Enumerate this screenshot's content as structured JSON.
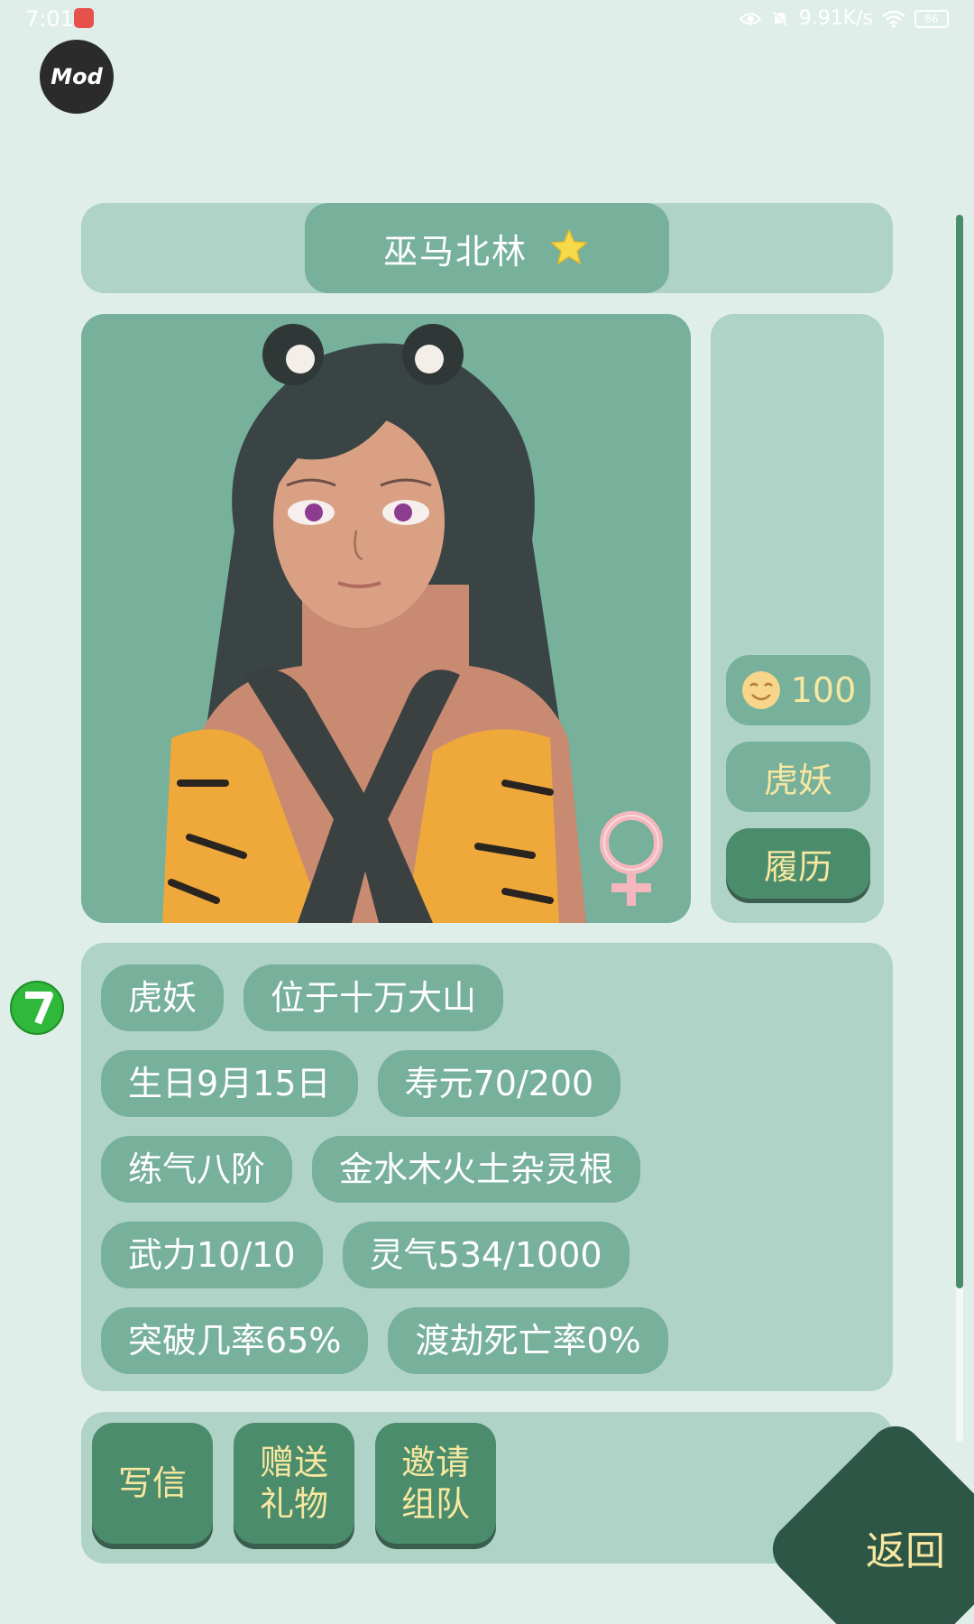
{
  "status_bar": {
    "time": "7:01",
    "network_speed": "9.91K/s",
    "battery": "86",
    "icons": [
      "app-notification-icon",
      "eye-icon",
      "mute-bell-icon",
      "wifi-icon",
      "battery-icon"
    ]
  },
  "mod_badge": {
    "label": "Mod"
  },
  "character": {
    "name": "巫马北林",
    "favorite_icon": "star-icon",
    "gender_icon": "female-icon",
    "portrait_icon": "tiger-girl-portrait"
  },
  "side": {
    "mood_value": "100",
    "mood_icon": "smile-icon",
    "race": "虎妖",
    "history_button": "履历"
  },
  "info_tags": {
    "race": "虎妖",
    "location": "位于十万大山",
    "birthday": "生日9月15日",
    "lifespan": "寿元70/200",
    "realm": "练气八阶",
    "spirit_root": "金水木火土杂灵根",
    "force": "武力10/10",
    "spirit": "灵气534/1000",
    "breakthrough": "突破几率65%",
    "tribulation": "渡劫死亡率0%"
  },
  "actions": {
    "write_letter": "写信",
    "send_gift": "赠送礼物",
    "invite_team": "邀请组队"
  },
  "back_button": "返回",
  "colors": {
    "background": "#dfeee9",
    "panel": "#b0d3c7",
    "pill": "#77b09b",
    "button": "#4a8c6c",
    "button_text": "#f7e7a0",
    "back": "#2e5646"
  }
}
